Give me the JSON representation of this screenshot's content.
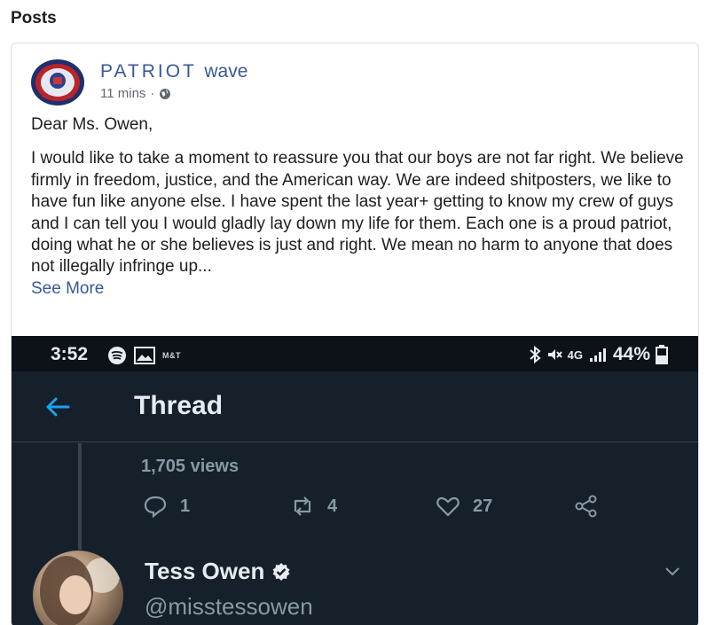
{
  "section": {
    "title": "Posts"
  },
  "post": {
    "page_name_spaced": "PATRIOT",
    "page_name_rest": "wave",
    "time": "11 mins",
    "meta_sep": "·",
    "greeting": "Dear Ms. Owen,",
    "body": "I would like to take a moment to reassure you that our boys are not far right. We believe firmly in freedom, justice, and the American way. We are indeed shitposters, we like to have fun like anyone else. I have spent the last year+ getting to know my crew of guys and I can tell you I would gladly lay down my life for them. Each one is a proud patriot, doing what he or she believes is just and right. We mean no harm to anyone that does not illegally infringe up...",
    "see_more": "See More"
  },
  "phone": {
    "status": {
      "time": "3:52",
      "carrier_icon": "M&T",
      "network": "4G",
      "battery": "44%"
    },
    "nav": {
      "title": "Thread",
      "back_icon": "back-arrow-icon"
    },
    "tweet_stats": {
      "views": "1,705 views",
      "replies": "1",
      "retweets": "4",
      "likes": "27"
    },
    "author": {
      "name": "Tess Owen",
      "handle": "@misstessowen"
    }
  },
  "colors": {
    "link": "#385898",
    "dark_bg": "#15202b",
    "twitter_blue": "#1da1f2",
    "muted": "#8899a6"
  }
}
